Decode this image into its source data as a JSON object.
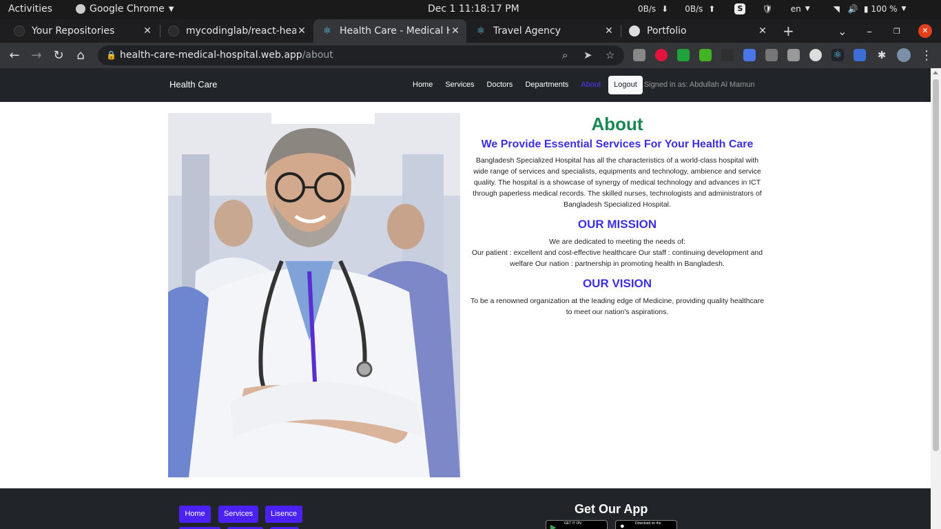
{
  "system": {
    "activities": "Activities",
    "app_name": "Google Chrome",
    "clock": "Dec 1  11:18:17 PM",
    "net_down": "0B/s",
    "net_up": "0B/s",
    "lang": "en",
    "battery": "100 %"
  },
  "tabs": [
    {
      "title": "Your Repositories",
      "icon": "github-icon",
      "active": false
    },
    {
      "title": "mycodinglab/react-hea",
      "icon": "github-icon",
      "active": false
    },
    {
      "title": "Health Care - Medical H",
      "icon": "react-icon",
      "active": true
    },
    {
      "title": "Travel Agency",
      "icon": "react-icon",
      "active": false
    },
    {
      "title": "Portfolio",
      "icon": "globe-icon",
      "active": false
    }
  ],
  "address_bar": {
    "domain": "health-care-medical-hospital.web.app",
    "path": "/about"
  },
  "site": {
    "brand": "Health Care",
    "nav": [
      "Home",
      "Services",
      "Doctors",
      "Departments",
      "About"
    ],
    "active_nav": "About",
    "logout": "Logout",
    "signed_in": "Signed in as: Abdullah Al Mamun"
  },
  "about": {
    "title": "About",
    "subtitle": "We Provide Essential Services For Your Health Care",
    "intro": "Bangladesh Specialized Hospital has all the characteristics of a world-class hospital with wide range of services and specialists, equipments and technology, ambience and service quality. The hospital is a showcase of synergy of medical technology and advances in ICT through paperless medical records. The skilled nurses, technologists and administrators of Bangladesh Specialized Hospital.",
    "mission_title": "OUR MISSION",
    "mission_lead": "We are dedicated to meeting the needs of:",
    "mission_text": "Our patient : excellent and cost-effective healthcare Our staff : continuing development and welfare Our nation : partnership in promoting health in Bangladesh.",
    "vision_title": "OUR VISION",
    "vision_text": "To be a renowned organization at the leading edge of Medicine, providing quality healthcare to meet our nation's aspirations."
  },
  "footer": {
    "links": [
      "Home",
      "Services",
      "Lisence"
    ],
    "get_app": "Get Our App",
    "google_play": "GET IT ON",
    "app_store": "Download on the"
  },
  "colors": {
    "accent_green": "#198754",
    "accent_blue": "#3d2fe0",
    "button_purple": "#4a22f5",
    "navbar": "#212529"
  }
}
